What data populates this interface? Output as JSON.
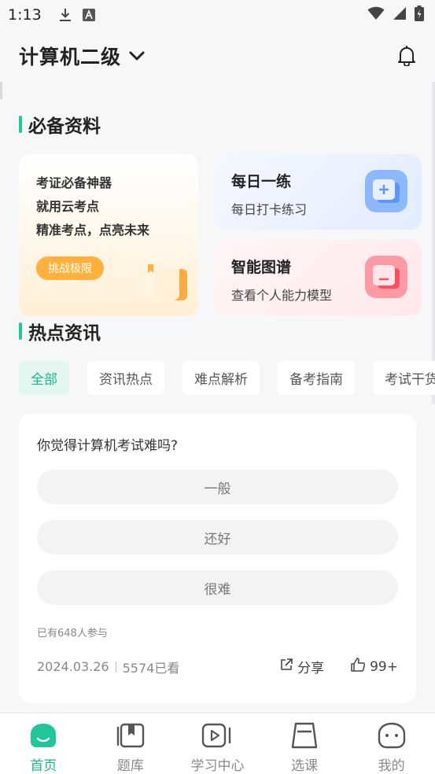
{
  "status_bar": {
    "time": "1:13"
  },
  "header": {
    "exam_title": "计算机二级"
  },
  "section_materials": {
    "title": "必备资料"
  },
  "promo": {
    "line1": "考证必备神器",
    "line2": "就用云考点",
    "line3": "精准考点，点亮未来",
    "button": "挑战极限"
  },
  "feature_daily": {
    "title": "每日一练",
    "subtitle": "每日打卡练习"
  },
  "feature_graph": {
    "title": "智能图谱",
    "subtitle": "查看个人能力模型"
  },
  "section_news": {
    "title": "热点资讯"
  },
  "tabs": [
    {
      "label": "全部"
    },
    {
      "label": "资讯热点"
    },
    {
      "label": "难点解析"
    },
    {
      "label": "备考指南"
    },
    {
      "label": "考试干货"
    }
  ],
  "poll": {
    "question": "你觉得计算机考试难吗?",
    "options": [
      {
        "label": "一般"
      },
      {
        "label": "还好"
      },
      {
        "label": "很难"
      }
    ],
    "participants": "已有648人参与",
    "date": "2024.03.26",
    "views": "5574已看",
    "share_label": "分享",
    "like_count": "99+"
  },
  "bottom_nav": [
    {
      "label": "首页"
    },
    {
      "label": "题库"
    },
    {
      "label": "学习中心"
    },
    {
      "label": "选课"
    },
    {
      "label": "我的"
    }
  ],
  "colors": {
    "accent": "#1fc79a",
    "promo_button": "#ffb13b",
    "blue_icon": "#7ab0ff",
    "pink_icon": "#ff7f8e"
  }
}
